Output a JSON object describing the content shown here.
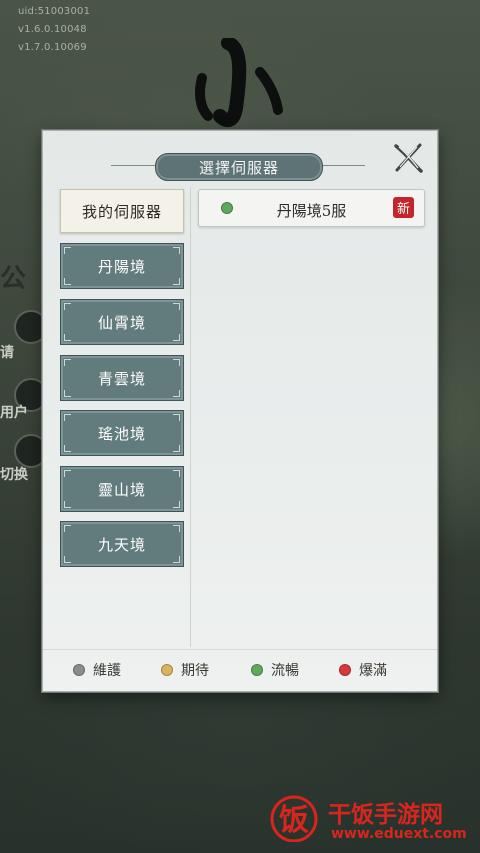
{
  "background": {
    "version_lines": [
      "uid:51003001",
      "v1.6.0.10048",
      "v1.7.0.10069"
    ],
    "side_labels": [
      "公",
      "请",
      "用户",
      "切换"
    ]
  },
  "dialog": {
    "title": "選擇伺服器",
    "close_icon": "close-x-icon",
    "active_tab": "我的伺服器",
    "tabs": [
      "丹陽境",
      "仙霄境",
      "青雲境",
      "瑤池境",
      "靈山境",
      "九天境"
    ],
    "servers": [
      {
        "name": "丹陽境5服",
        "status": "流暢",
        "status_color": "#5fa95a",
        "badge": "新"
      }
    ],
    "legend": [
      {
        "label": "維護",
        "color": "#8c8c8c"
      },
      {
        "label": "期待",
        "color": "#d8b45c"
      },
      {
        "label": "流暢",
        "color": "#5fa95a"
      },
      {
        "label": "爆滿",
        "color": "#d6393b"
      }
    ]
  },
  "watermark": {
    "logo_char": "饭",
    "title": "干饭手游网",
    "url": "www.eduext.com"
  },
  "colors": {
    "tab_bg": "#627b7d",
    "active_tab_bg": "#f4f1e8",
    "badge_red": "#c3262a",
    "watermark_red": "#d8251d"
  }
}
